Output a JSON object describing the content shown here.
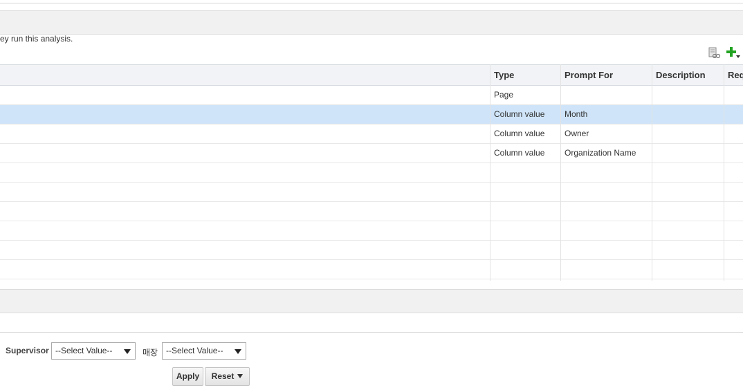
{
  "info_text": "ey run this analysis.",
  "toolbar": {
    "edit_icon": "edit-prompt-icon",
    "add_icon": "add-prompt-icon",
    "add_color": "#22a322"
  },
  "grid": {
    "columns": [
      "Type",
      "Prompt For",
      "Description",
      "Req"
    ],
    "rows": [
      {
        "type": "Page",
        "prompt_for": "",
        "description": "",
        "req": ""
      },
      {
        "type": "Column value",
        "prompt_for": "Month",
        "description": "",
        "req": ""
      },
      {
        "type": "Column value",
        "prompt_for": "Owner",
        "description": "",
        "req": ""
      },
      {
        "type": "Column value",
        "prompt_for": "Organization Name",
        "description": "",
        "req": ""
      }
    ],
    "selected_color": "#cfe4f8"
  },
  "prompts": {
    "supervisor_label": "Supervisor",
    "supervisor_value": "--Select Value--",
    "store_label": "매장",
    "store_value": "--Select Value--",
    "apply_label": "Apply",
    "reset_label": "Reset"
  }
}
